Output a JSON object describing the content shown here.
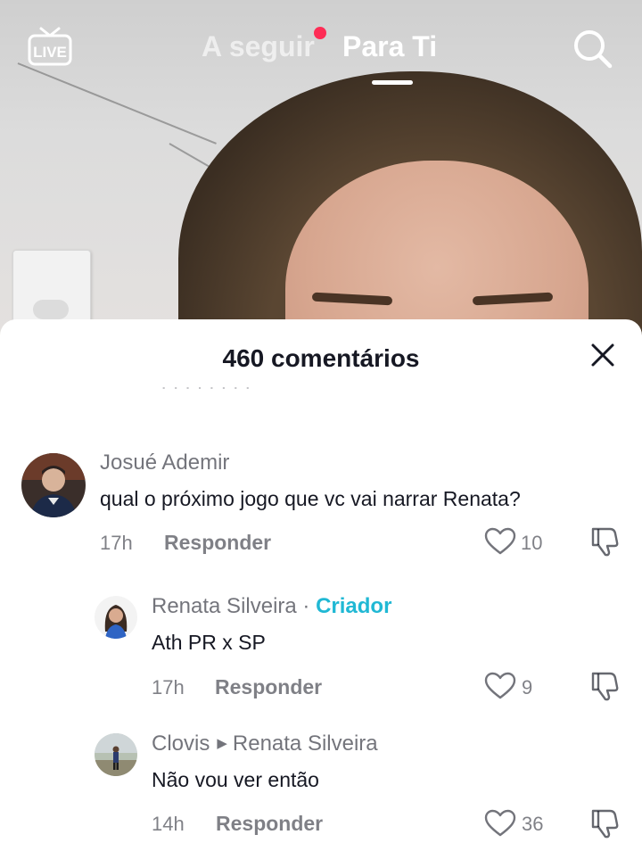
{
  "header": {
    "live_label": "LIVE",
    "tab_following": "A seguir",
    "tab_for_you": "Para Ti"
  },
  "sheet": {
    "title": "460 comentários",
    "faded_text": "· · · · · · · ·"
  },
  "comments": [
    {
      "username": "Josué Ademir",
      "text": "qual o próximo jogo que vc vai narrar Renata?",
      "time": "17h",
      "reply_label": "Responder",
      "likes": "10"
    },
    {
      "username": "Renata Silveira",
      "badge_sep": " · ",
      "badge": "Criador",
      "text": "Ath PR x SP",
      "time": "17h",
      "reply_label": "Responder",
      "likes": "9"
    },
    {
      "username": "Clovis",
      "reply_to": "Renata Silveira",
      "text": "Não vou ver então",
      "time": "14h",
      "reply_label": "Responder",
      "likes": "36"
    }
  ],
  "colors": {
    "accent": "#fe2c55",
    "creator": "#20b8d4"
  }
}
